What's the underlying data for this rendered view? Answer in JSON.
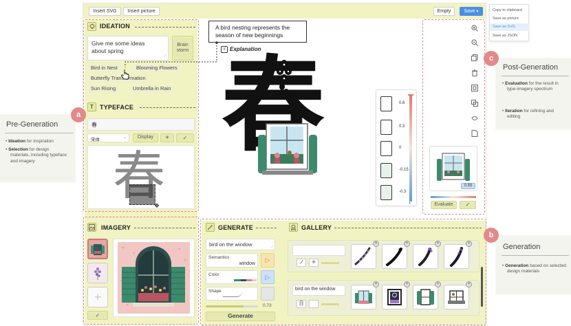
{
  "toolbar": {
    "insert_svg": "Insert SVG",
    "insert_picture": "Insert picture",
    "empty": "Empty",
    "save": "Save"
  },
  "save_menu": [
    "Copy to clipboard",
    "Save as picture",
    "Save as SVG",
    "Save as JSON"
  ],
  "ideation": {
    "title": "IDEATION",
    "prompt": "Give me some ideas about spring",
    "brainstorm": "Brain storm",
    "chips": [
      "Bird in Nest",
      "Blooming Flowers",
      "Butterfly Transformation",
      "Sun Rising",
      "Umbrella in Rain"
    ]
  },
  "typeface": {
    "title": "TYPEFACE",
    "char": "春",
    "font": "宋体",
    "display": "Display",
    "preview_char": "春"
  },
  "imagery": {
    "title": "IMAGERY"
  },
  "generate": {
    "title": "GENERATE",
    "prompt": "bird on the window",
    "semantics_label": "Semantics",
    "semantics_value": "window",
    "color_label": "Color",
    "shape_label": "Shape",
    "shape_value": "0.73",
    "generate_label": "Generate"
  },
  "gallery": {
    "title": "GALLERY",
    "row2_prompt": "bird on the window"
  },
  "canvas": {
    "explanation_text": "A bird nesting represents the season of new beginnings",
    "explanation_label": "Explanation",
    "main_char": "春",
    "spectrum_values": [
      "0.6",
      "0.3",
      "0",
      "-0.15",
      "-0.3"
    ],
    "eval_score": "0.55",
    "evaluate": "Evaluate"
  },
  "annotations": {
    "a": "a",
    "b": "b",
    "c": "c",
    "pre_title": "Pre-Generation",
    "pre_b1_bold": "Ideation",
    "pre_b1": " for inspiration",
    "pre_b2_bold": "Selection",
    "pre_b2": " for design materials, including typeface and imagery",
    "post_title": "Post-Generation",
    "post_b1_bold": "Evaluation",
    "post_b1": " for the result in type-imagery spectrum",
    "post_b2_bold": "Iteration",
    "post_b2": " for refining and editing",
    "gen_title": "Generation",
    "gen_b1_bold": "Generation",
    "gen_b1": " based on selected design materials"
  },
  "colors": {
    "accent": "#e3898a",
    "panel_yellow": "#f1f3c2",
    "save_blue": "#4a90e2"
  }
}
